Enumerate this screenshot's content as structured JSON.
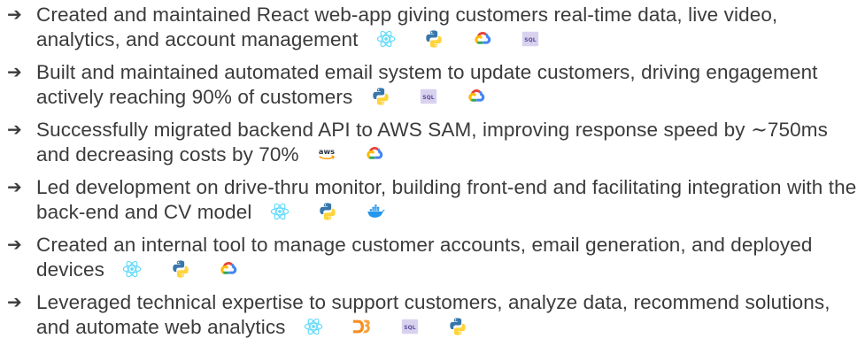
{
  "bullets": [
    {
      "arrow": "➔",
      "text": "Created and maintained React web-app giving customers real-time data, live video, analytics, and account management",
      "icons": [
        "react-icon",
        "python-icon",
        "google-cloud-icon",
        "sql-icon"
      ]
    },
    {
      "arrow": "➔",
      "text": "Built and maintained automated email system to update customers, driving engagement actively reaching 90% of customers",
      "icons": [
        "python-icon",
        "sql-icon",
        "google-cloud-icon"
      ]
    },
    {
      "arrow": "➔",
      "text_before": "Successfully migrated backend API to AWS SAM, improving response speed by ",
      "tilde": "∼",
      "text_after": "750ms and decreasing costs by 70%",
      "icons": [
        "aws-icon",
        "google-cloud-icon"
      ]
    },
    {
      "arrow": "➔",
      "text": "Led development on drive-thru monitor, building front-end and facilitating integration with the back-end and CV model",
      "icons": [
        "react-icon",
        "python-icon",
        "docker-icon"
      ]
    },
    {
      "arrow": "➔",
      "text": "Created an internal tool to manage customer accounts, email generation, and deployed devices",
      "icons": [
        "react-icon",
        "python-icon",
        "google-cloud-icon"
      ]
    },
    {
      "arrow": "➔",
      "text": "Leveraged technical expertise to support customers, analyze data, recommend solutions, and automate web analytics",
      "icons": [
        "react-icon",
        "d3-icon",
        "sql-icon",
        "python-icon"
      ]
    }
  ],
  "icon_labels": {
    "sql": "SQL",
    "aws": "aws"
  },
  "colors": {
    "text": "#3b3b3b",
    "react": "#61dafb",
    "python_blue": "#3776ab",
    "python_yellow": "#ffd43b",
    "gcloud_red": "#ea4335",
    "gcloud_blue": "#4285f4",
    "gcloud_yellow": "#fbbc05",
    "gcloud_green": "#34a853",
    "docker": "#2496ed",
    "d3": "#f68e1e",
    "sql_bg": "#d9d2ef",
    "sql_text": "#5c4b9e"
  }
}
